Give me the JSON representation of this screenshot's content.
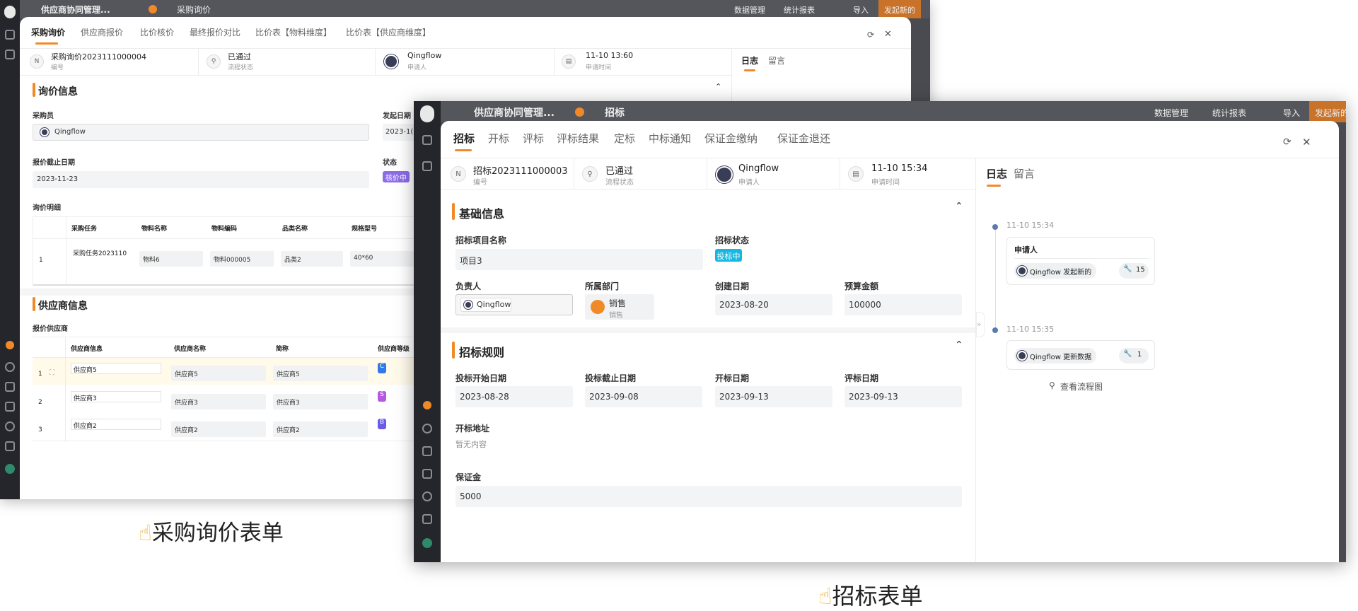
{
  "shot1": {
    "app_title": "供应商协同管理...",
    "app_tab": "采购询价",
    "toolbar": {
      "data_mgmt": "数据管理",
      "stats": "统计报表",
      "import": "导入",
      "new": "发起新的"
    },
    "tabs": [
      "采购询价",
      "供应商报价",
      "比价核价",
      "最终报价对比",
      "比价表【物料维度】",
      "比价表【供应商维度】"
    ],
    "info": [
      {
        "value": "采购询价2023111000004",
        "label": "编号"
      },
      {
        "value": "已通过",
        "label": "流程状态"
      },
      {
        "value": "Qingflow",
        "label": "申请人"
      },
      {
        "value": "11-10 13:60",
        "label": "申请时间"
      }
    ],
    "side_tabs": [
      "日志",
      "留言"
    ],
    "section1_title": "询价信息",
    "buyer_label": "采购员",
    "buyer_value": "Qingflow",
    "start_date_label": "发起日期",
    "start_date_value": "2023-1(",
    "deadline_label": "报价截止日期",
    "deadline_value": "2023-11-23",
    "status_label": "状态",
    "status_value": "核价中",
    "detail_label": "询价明细",
    "detail_headers": [
      "采购任务",
      "物料名称",
      "物料编码",
      "品类名称",
      "规格型号"
    ],
    "detail_row": {
      "no": "1",
      "task": "采购任务2023110",
      "material": "物料6",
      "code": "物料000005",
      "category": "品类2",
      "spec": "40*60"
    },
    "section2_title": "供应商信息",
    "supplier_label": "报价供应商",
    "supplier_headers": [
      "供应商信息",
      "供应商名称",
      "简称",
      "供应商等级"
    ],
    "supplier_rows": [
      {
        "no": "1",
        "info": "供应商5",
        "name": "供应商5",
        "short": "供应商5",
        "grade": "C"
      },
      {
        "no": "2",
        "info": "供应商3",
        "name": "供应商3",
        "short": "供应商3",
        "grade": "S"
      },
      {
        "no": "3",
        "info": "供应商2",
        "name": "供应商2",
        "short": "供应商2",
        "grade": "B"
      }
    ]
  },
  "shot2": {
    "app_title": "供应商协同管理...",
    "app_tab": "招标",
    "toolbar": {
      "data_mgmt": "数据管理",
      "stats": "统计报表",
      "import": "导入",
      "new": "发起新的"
    },
    "tabs": [
      "招标",
      "开标",
      "评标",
      "评标结果",
      "定标",
      "中标通知",
      "保证金缴纳",
      "保证金退还"
    ],
    "info": [
      {
        "value": "招标2023111000003",
        "label": "编号"
      },
      {
        "value": "已通过",
        "label": "流程状态"
      },
      {
        "value": "Qingflow",
        "label": "申请人"
      },
      {
        "value": "11-10 15:34",
        "label": "申请时间"
      }
    ],
    "side_tabs": [
      "日志",
      "留言"
    ],
    "section1_title": "基础信息",
    "project_name_label": "招标项目名称",
    "project_name_value": "项目3",
    "bid_status_label": "招标状态",
    "bid_status_value": "投标中",
    "owner_label": "负责人",
    "owner_value": "Qingflow",
    "dept_label": "所属部门",
    "dept_value": "销售",
    "dept_sub": "销售",
    "created_label": "创建日期",
    "created_value": "2023-08-20",
    "budget_label": "预算金额",
    "budget_value": "100000",
    "section2_title": "招标规则",
    "bid_start_label": "投标开始日期",
    "bid_start_value": "2023-08-28",
    "bid_end_label": "投标截止日期",
    "bid_end_value": "2023-09-08",
    "open_date_label": "开标日期",
    "open_date_value": "2023-09-13",
    "eval_date_label": "评标日期",
    "eval_date_value": "2023-09-13",
    "address_label": "开标地址",
    "address_value": "暂无内容",
    "deposit_label": "保证金",
    "deposit_value": "5000",
    "log": [
      {
        "time": "11-10 15:34",
        "title": "申请人",
        "text": "Qingflow 发起新的",
        "count": "15"
      },
      {
        "time": "11-10 15:35",
        "text": "Qingflow 更新数据",
        "count": "1"
      }
    ],
    "flow_link": "查看流程图"
  },
  "captions": {
    "left": "采购询价表单",
    "right": "招标表单"
  }
}
